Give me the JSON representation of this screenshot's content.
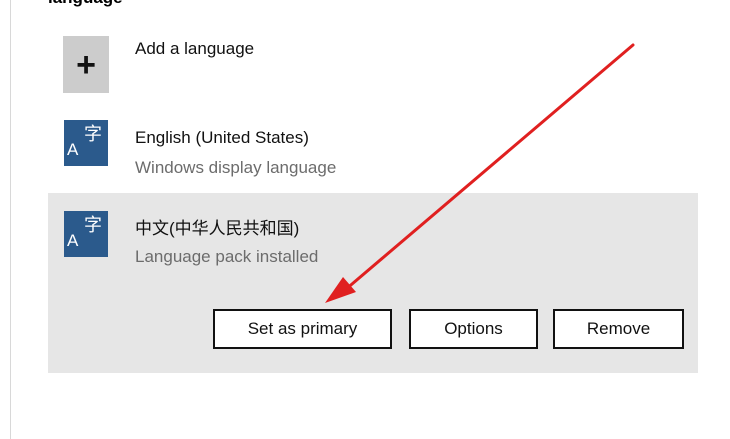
{
  "section": {
    "heading": "language"
  },
  "add_language": {
    "icon": "plus-icon",
    "label": "Add a language"
  },
  "languages": [
    {
      "icon": "language-character-icon",
      "icon_text_a": "A",
      "icon_text_zi": "字",
      "name": "English (United States)",
      "status": "Windows display language"
    },
    {
      "icon": "language-character-icon",
      "icon_text_a": "A",
      "icon_text_zi": "字",
      "name": "中文(中华人民共和国)",
      "status": "Language pack installed",
      "selected": true
    }
  ],
  "actions": {
    "set_primary_label": "Set as primary",
    "options_label": "Options",
    "remove_label": "Remove"
  },
  "colors": {
    "language_tile": "#2b5a8c",
    "add_tile": "#cccccc",
    "selected_row": "#e6e6e6",
    "annotation_arrow": "#e02020"
  }
}
